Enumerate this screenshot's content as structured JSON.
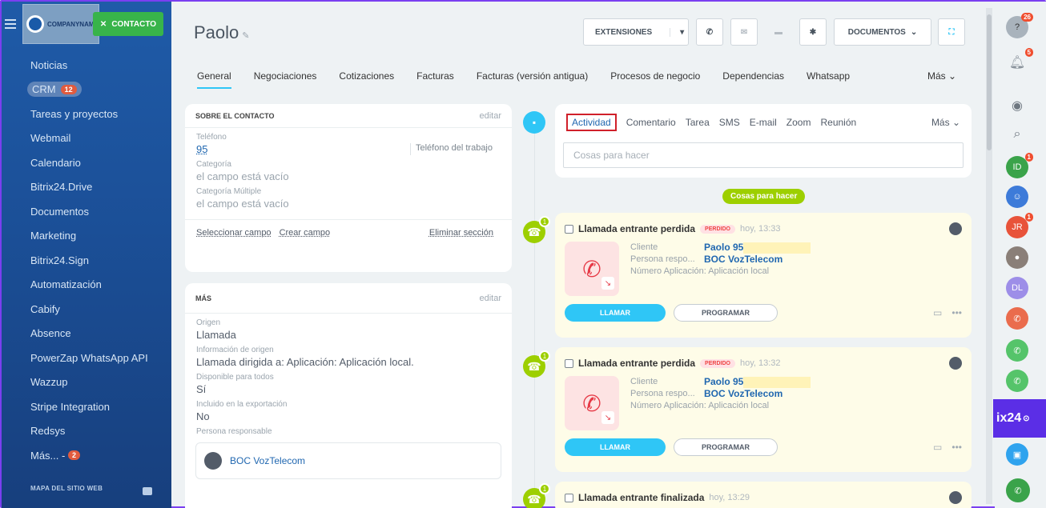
{
  "sidebar": {
    "logo_text": "COMPANYNAME",
    "contact_button": "CONTACTO",
    "items": [
      {
        "label": "Noticias"
      },
      {
        "label": "CRM",
        "badge": "12"
      },
      {
        "label": "Tareas y proyectos"
      },
      {
        "label": "Webmail"
      },
      {
        "label": "Calendario"
      },
      {
        "label": "Bitrix24.Drive"
      },
      {
        "label": "Documentos"
      },
      {
        "label": "Marketing"
      },
      {
        "label": "Bitrix24.Sign"
      },
      {
        "label": "Automatización"
      },
      {
        "label": "Cabify"
      },
      {
        "label": "Absence"
      },
      {
        "label": "PowerZap WhatsApp API"
      },
      {
        "label": "Wazzup"
      },
      {
        "label": "Stripe Integration"
      },
      {
        "label": "Redsys"
      },
      {
        "label": "Más... -",
        "badge": "2"
      }
    ],
    "sitemap": "MAPA DEL SITIO WEB"
  },
  "header": {
    "title": "Paolo",
    "extensions": "EXTENSIONES",
    "documents": "DOCUMENTOS"
  },
  "tabs": [
    "General",
    "Negociaciones",
    "Cotizaciones",
    "Facturas",
    "Facturas (versión antigua)",
    "Procesos de negocio",
    "Dependencias",
    "Whatsapp"
  ],
  "tabs_more": "Más",
  "about": {
    "heading": "SOBRE EL CONTACTO",
    "edit": "editar",
    "phone_label": "Teléfono",
    "phone_value": "95",
    "phone_type": "Teléfono del trabajo",
    "category_label": "Categoría",
    "category_value": "el campo está vacío",
    "multi_label": "Categoría Múltiple",
    "multi_value": "el campo está vacío",
    "select_field": "Seleccionar campo",
    "create_field": "Crear campo",
    "delete_section": "Eliminar sección"
  },
  "more": {
    "heading": "MÁS",
    "edit": "editar",
    "fields": [
      {
        "label": "Origen",
        "value": "Llamada"
      },
      {
        "label": "Información de origen",
        "value": "Llamada dirigida a: Aplicación: Aplicación local."
      },
      {
        "label": "Disponible para todos",
        "value": "Sí"
      },
      {
        "label": "Incluido en la exportación",
        "value": "No"
      }
    ],
    "responsible_label": "Persona responsable",
    "responsible": "BOC VozTelecom"
  },
  "activity": {
    "tabs": [
      "Actividad",
      "Comentario",
      "Tarea",
      "SMS",
      "E-mail",
      "Zoom",
      "Reunión"
    ],
    "more": "Más",
    "placeholder": "Cosas para hacer",
    "pill": "Cosas para hacer"
  },
  "calls": [
    {
      "title": "Llamada entrante perdida",
      "status": "PERDIDO",
      "time": "hoy, 13:33",
      "client_label": "Cliente",
      "client": "Paolo 95",
      "resp_label": "Persona respo...",
      "resp": "BOC VozTelecom",
      "app": "Número Aplicación: Aplicación local",
      "call": "LLAMAR",
      "schedule": "PROGRAMAR"
    },
    {
      "title": "Llamada entrante perdida",
      "status": "PERDIDO",
      "time": "hoy, 13:32",
      "client_label": "Cliente",
      "client": "Paolo 95",
      "resp_label": "Persona respo...",
      "resp": "BOC VozTelecom",
      "app": "Número Aplicación: Aplicación local",
      "call": "LLAMAR",
      "schedule": "PROGRAMAR"
    },
    {
      "title": "Llamada entrante finalizada",
      "time": "hoy, 13:29"
    }
  ],
  "rightbar": {
    "notif_count": "26",
    "bell_count": "5",
    "avatars": [
      "ID",
      "JR",
      "DL"
    ]
  },
  "b24": "ix24"
}
